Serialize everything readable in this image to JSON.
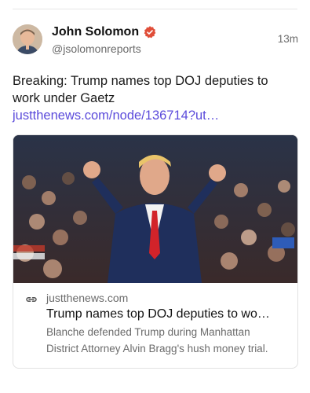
{
  "post": {
    "display_name": "John Solomon",
    "handle": "@jsolomonreports",
    "timestamp": "13m",
    "text": "Breaking: Trump names top DOJ deputies to work under Gaetz ",
    "link_text": "justthenews.com/node/136714?ut…",
    "verified_color": "#e04e39",
    "link_color": "#5b4bdb"
  },
  "card": {
    "domain": "justthenews.com",
    "title": "Trump names top DOJ deputies to wo…",
    "description": "Blanche defended Trump during Manhattan District Attorney Alvin Bragg's hush money trial."
  }
}
